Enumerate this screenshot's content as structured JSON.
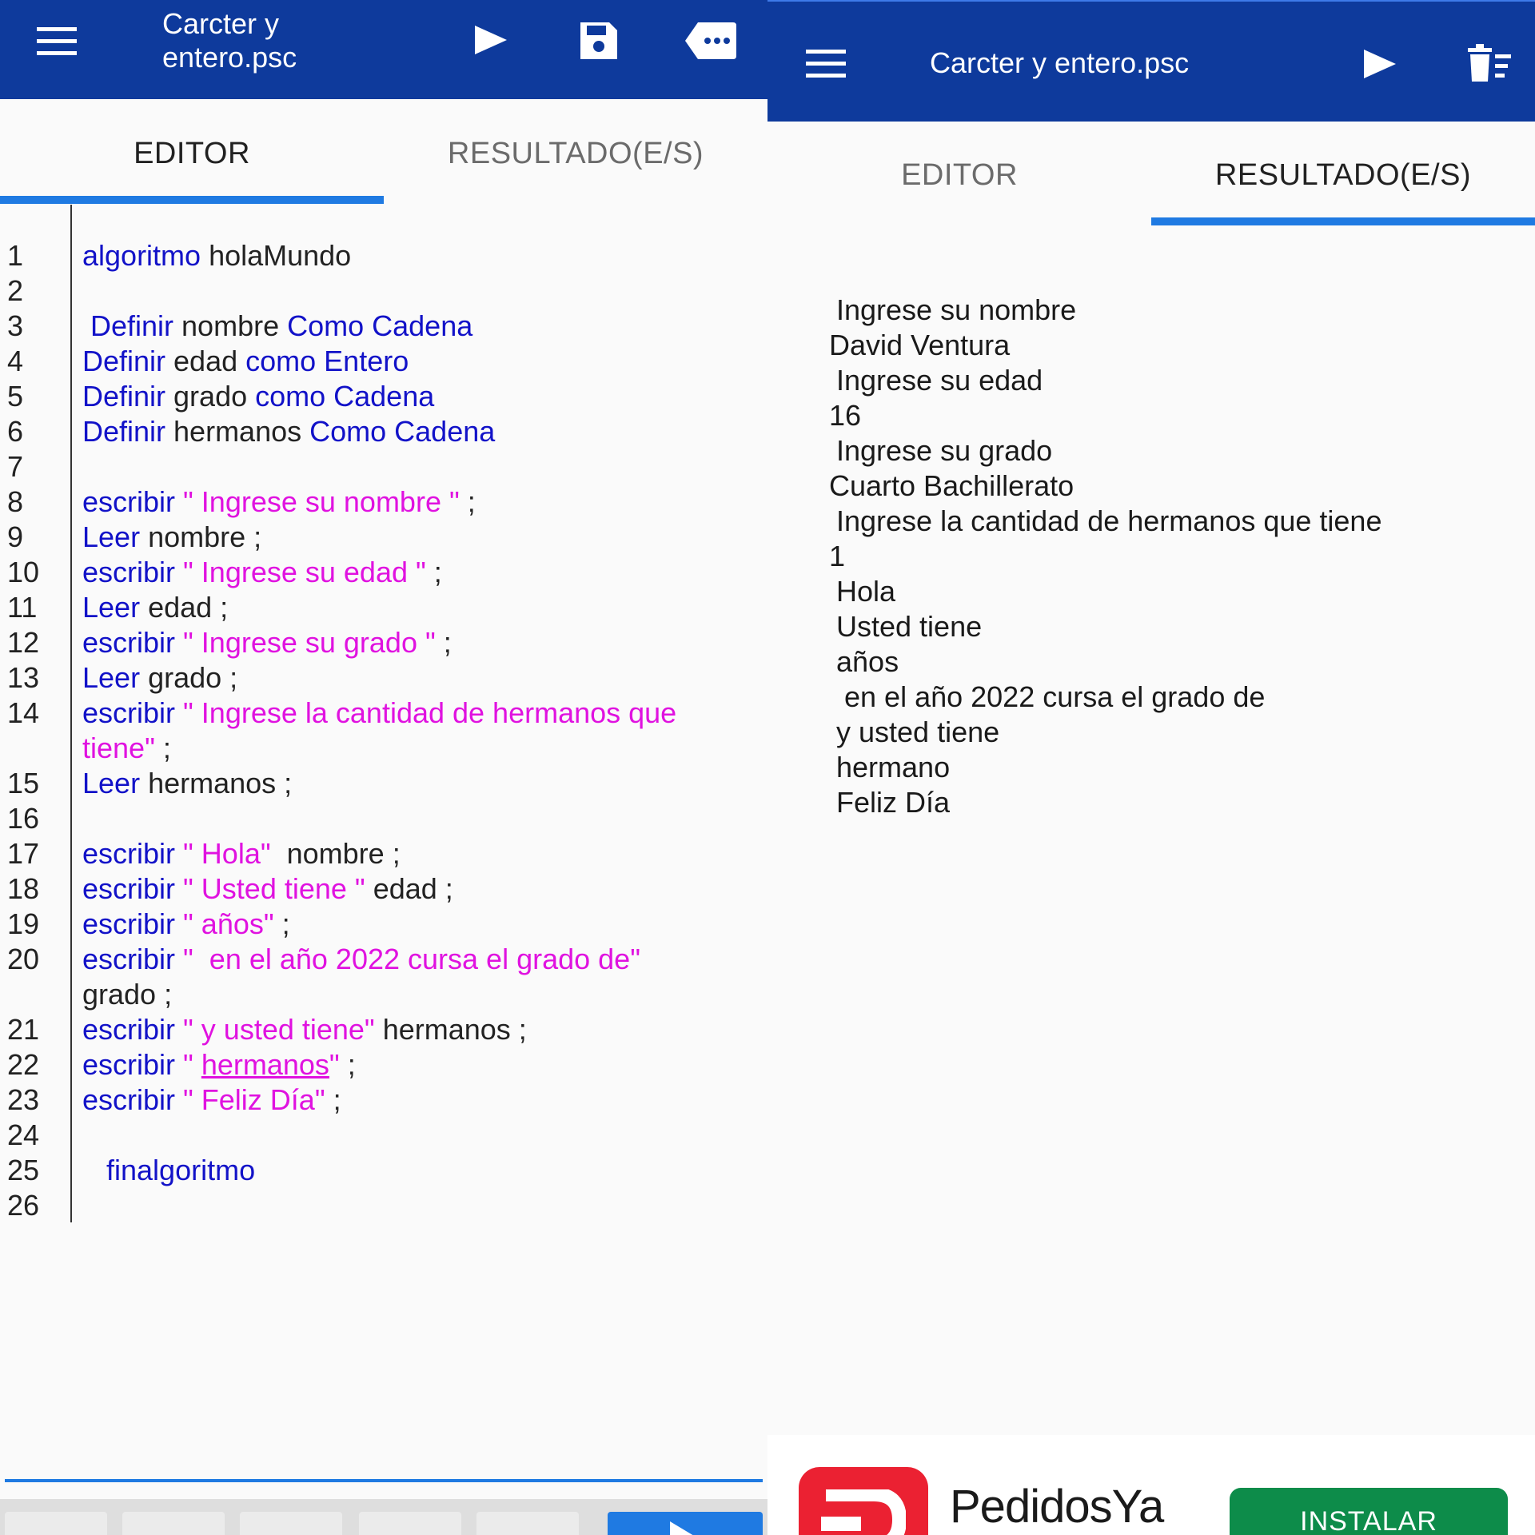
{
  "colors": {
    "appbar": "#0e3a9c",
    "tab_indicator": "#1f7ae2",
    "keyword": "#1212c8",
    "string": "#e012e0",
    "ad_button": "#0d8c4a",
    "ad_logo": "#eb2132"
  },
  "editor_screen": {
    "appbar": {
      "title_line1": "Carcter y",
      "title_line2": "entero.psc",
      "icons": [
        "menu-icon",
        "play-icon",
        "save-icon",
        "more-tag-icon"
      ]
    },
    "tabs": [
      {
        "label": "EDITOR",
        "active": true
      },
      {
        "label": "RESULTADO(E/S)",
        "active": false
      }
    ],
    "code_lines": [
      {
        "num": "1",
        "tokens": [
          {
            "t": "algoritmo",
            "c": "kw"
          },
          {
            "t": " holaMundo",
            "c": "pl"
          }
        ]
      },
      {
        "num": "2",
        "tokens": []
      },
      {
        "num": "3",
        "tokens": [
          {
            "t": " Definir",
            "c": "kw"
          },
          {
            "t": " nombre ",
            "c": "pl"
          },
          {
            "t": "Como Cadena",
            "c": "kw"
          }
        ]
      },
      {
        "num": "4",
        "tokens": [
          {
            "t": "Definir",
            "c": "kw"
          },
          {
            "t": " edad ",
            "c": "pl"
          },
          {
            "t": "como Entero",
            "c": "kw"
          }
        ]
      },
      {
        "num": "5",
        "tokens": [
          {
            "t": "Definir",
            "c": "kw"
          },
          {
            "t": " grado ",
            "c": "pl"
          },
          {
            "t": "como Cadena",
            "c": "kw"
          }
        ]
      },
      {
        "num": "6",
        "tokens": [
          {
            "t": "Definir",
            "c": "kw"
          },
          {
            "t": " hermanos ",
            "c": "pl"
          },
          {
            "t": "Como Cadena",
            "c": "kw"
          }
        ]
      },
      {
        "num": "7",
        "tokens": []
      },
      {
        "num": "8",
        "tokens": [
          {
            "t": "escribir",
            "c": "kw"
          },
          {
            "t": " \" Ingrese su nombre \"",
            "c": "st"
          },
          {
            "t": " ;",
            "c": "pl"
          }
        ]
      },
      {
        "num": "9",
        "tokens": [
          {
            "t": "Leer",
            "c": "kw"
          },
          {
            "t": " nombre ;",
            "c": "pl"
          }
        ]
      },
      {
        "num": "10",
        "tokens": [
          {
            "t": "escribir",
            "c": "kw"
          },
          {
            "t": " \" Ingrese su edad \"",
            "c": "st"
          },
          {
            "t": " ;",
            "c": "pl"
          }
        ]
      },
      {
        "num": "11",
        "tokens": [
          {
            "t": "Leer",
            "c": "kw"
          },
          {
            "t": " edad ;",
            "c": "pl"
          }
        ]
      },
      {
        "num": "12",
        "tokens": [
          {
            "t": "escribir",
            "c": "kw"
          },
          {
            "t": " \" Ingrese su grado \"",
            "c": "st"
          },
          {
            "t": " ;",
            "c": "pl"
          }
        ]
      },
      {
        "num": "13",
        "tokens": [
          {
            "t": "Leer",
            "c": "kw"
          },
          {
            "t": " grado ;",
            "c": "pl"
          }
        ]
      },
      {
        "num": "14",
        "tokens": [
          {
            "t": "escribir",
            "c": "kw"
          },
          {
            "t": " \" Ingrese la cantidad de hermanos que",
            "c": "st"
          }
        ]
      },
      {
        "num": "",
        "tokens": [
          {
            "t": "tiene\"",
            "c": "st"
          },
          {
            "t": " ;",
            "c": "pl"
          }
        ]
      },
      {
        "num": "15",
        "tokens": [
          {
            "t": "Leer",
            "c": "kw"
          },
          {
            "t": " hermanos ;",
            "c": "pl"
          }
        ]
      },
      {
        "num": "16",
        "tokens": []
      },
      {
        "num": "17",
        "tokens": [
          {
            "t": "escribir",
            "c": "kw"
          },
          {
            "t": " \" Hola\"",
            "c": "st"
          },
          {
            "t": "  nombre ;",
            "c": "pl"
          }
        ]
      },
      {
        "num": "18",
        "tokens": [
          {
            "t": "escribir",
            "c": "kw"
          },
          {
            "t": " \" Usted tiene \"",
            "c": "st"
          },
          {
            "t": " edad ;",
            "c": "pl"
          }
        ]
      },
      {
        "num": "19",
        "tokens": [
          {
            "t": "escribir",
            "c": "kw"
          },
          {
            "t": " \" años\"",
            "c": "st"
          },
          {
            "t": " ;",
            "c": "pl"
          }
        ]
      },
      {
        "num": "20",
        "tokens": [
          {
            "t": "escribir",
            "c": "kw"
          },
          {
            "t": " \"  en el año 2022 cursa el grado de\"",
            "c": "st"
          }
        ]
      },
      {
        "num": "",
        "tokens": [
          {
            "t": "grado ;",
            "c": "pl"
          }
        ]
      },
      {
        "num": "21",
        "tokens": [
          {
            "t": "escribir",
            "c": "kw"
          },
          {
            "t": " \" y usted tiene\"",
            "c": "st"
          },
          {
            "t": " hermanos ;",
            "c": "pl"
          }
        ]
      },
      {
        "num": "22",
        "tokens": [
          {
            "t": "escribir",
            "c": "kw"
          },
          {
            "t": " \" ",
            "c": "st"
          },
          {
            "t": "hermanos",
            "c": "st u"
          },
          {
            "t": "\"",
            "c": "st"
          },
          {
            "t": " ;",
            "c": "pl"
          }
        ]
      },
      {
        "num": "23",
        "tokens": [
          {
            "t": "escribir",
            "c": "kw"
          },
          {
            "t": " \" Feliz Día\"",
            "c": "st"
          },
          {
            "t": " ;",
            "c": "pl"
          }
        ]
      },
      {
        "num": "24",
        "tokens": []
      },
      {
        "num": "25",
        "tokens": [
          {
            "t": "   finalgoritmo",
            "c": "kw"
          }
        ]
      },
      {
        "num": "26",
        "tokens": []
      }
    ]
  },
  "result_screen": {
    "appbar": {
      "title": "Carcter y entero.psc",
      "icons": [
        "menu-icon",
        "play-icon",
        "clear-console-icon"
      ]
    },
    "tabs": [
      {
        "label": "EDITOR",
        "active": false
      },
      {
        "label": "RESULTADO(E/S)",
        "active": true
      }
    ],
    "output_lines": [
      {
        "text": "Ingrese su nombre",
        "type": "prompt"
      },
      {
        "text": "David Ventura",
        "type": "input"
      },
      {
        "text": "Ingrese su edad",
        "type": "prompt"
      },
      {
        "text": "16",
        "type": "input"
      },
      {
        "text": "Ingrese su grado",
        "type": "prompt"
      },
      {
        "text": "Cuarto Bachillerato",
        "type": "input"
      },
      {
        "text": "Ingrese la cantidad de hermanos que tiene",
        "type": "prompt"
      },
      {
        "text": "1",
        "type": "input"
      },
      {
        "text": "Hola",
        "type": "prompt"
      },
      {
        "text": "Usted tiene",
        "type": "prompt"
      },
      {
        "text": "años",
        "type": "prompt"
      },
      {
        "text": " en el año 2022 cursa el grado de",
        "type": "prompt"
      },
      {
        "text": "y usted tiene",
        "type": "prompt"
      },
      {
        "text": "hermano",
        "type": "prompt"
      },
      {
        "text": "Feliz Día",
        "type": "prompt"
      }
    ],
    "ad": {
      "brand": "PedidosYa",
      "button_label": "INSTALAR"
    }
  }
}
